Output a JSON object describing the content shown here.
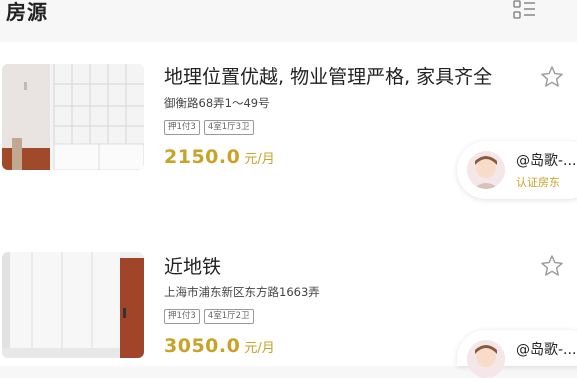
{
  "header": {
    "title": "房源"
  },
  "listings": [
    {
      "title": "地理位置优越, 物业管理严格, 家具齐全",
      "address": "御衡路68弄1～49号",
      "tags": [
        "押1付3",
        "4室1厅3卫"
      ],
      "price": "2150.0",
      "unit": "元/月",
      "agent": {
        "name": "@岛歌-...",
        "badge": "认证房东"
      }
    },
    {
      "title": "近地铁",
      "address": "上海市浦东新区东方路1663弄",
      "tags": [
        "押1付3",
        "4室1厅2卫"
      ],
      "price": "3050.0",
      "unit": "元/月",
      "agent": {
        "name": "@岛歌-..."
      }
    }
  ],
  "colors": {
    "price": "#c9a227",
    "badge": "#c9a227"
  },
  "icons": {
    "list_toggle": "list-view-icon",
    "favorite": "star-outline-icon"
  }
}
